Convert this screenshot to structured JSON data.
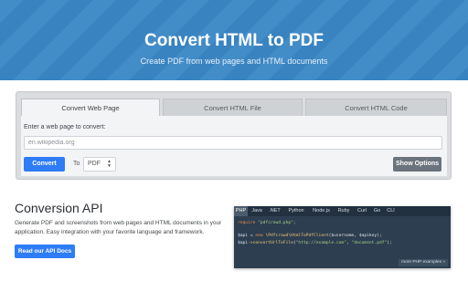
{
  "hero": {
    "title": "Convert HTML to PDF",
    "subtitle": "Create PDF from web pages and HTML documents"
  },
  "converter": {
    "tabs": [
      {
        "label": "Convert Web Page",
        "active": true
      },
      {
        "label": "Convert HTML File",
        "active": false
      },
      {
        "label": "Convert HTML Code",
        "active": false
      }
    ],
    "url_label": "Enter a web page to convert:",
    "url_placeholder": "en.wikipedia.org",
    "convert_label": "Convert",
    "to_label": "To",
    "format_selected": "PDF",
    "show_options_label": "Show Options"
  },
  "api": {
    "title": "Conversion API",
    "description": "Generate PDF and screenshots from web pages and HTML documents in your application. Easy integration with your favorite language and framework.",
    "docs_button": "Read our API Docs"
  },
  "code_panel": {
    "languages": [
      {
        "label": "PHP",
        "active": true
      },
      {
        "label": "Java",
        "active": false
      },
      {
        "label": ".NET",
        "active": false
      },
      {
        "label": "Python",
        "active": false
      },
      {
        "label": "Node.js",
        "active": false
      },
      {
        "label": "Ruby",
        "active": false
      },
      {
        "label": "Curl",
        "active": false
      },
      {
        "label": "Go",
        "active": false
      },
      {
        "label": "CLI",
        "active": false
      }
    ],
    "code": {
      "require_kw": "require",
      "require_str": " \"pdfcrowd.php\";",
      "line2_var": "$api",
      "line2_eq": " = ",
      "line2_new": "new",
      "line2_class": " \\Pdfcrowd\\HtmlToPdfClient",
      "line2_args": "($username, $apikey);",
      "line3_var": "$api",
      "line3_method": "->convertUrlToFile",
      "line3_args_open": "(",
      "line3_str1": "\"http://example.com\"",
      "line3_sep": ", ",
      "line3_str2": "\"document.pdf\"",
      "line3_close": ");"
    },
    "more_examples": "more PHP examples »"
  },
  "colors": {
    "hero_bg": "#3a87c6",
    "primary_button": "#2e7cf6",
    "secondary_button": "#6b747d",
    "code_bg": "#2c3e50"
  }
}
